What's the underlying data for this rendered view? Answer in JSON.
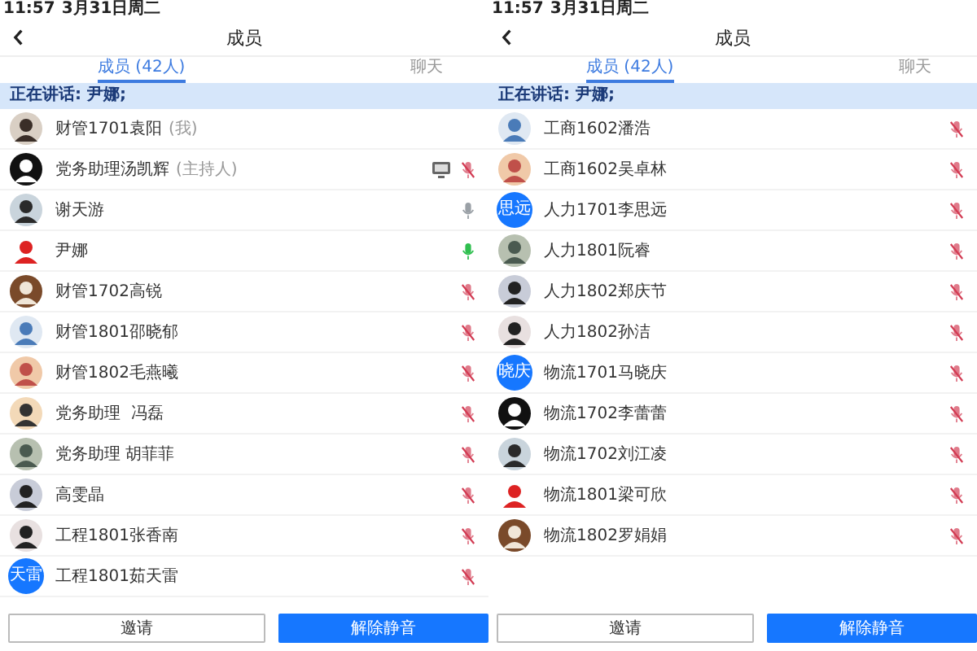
{
  "panels": [
    {
      "status": {
        "time": "11:57",
        "date": "3月31日周二"
      },
      "title": "成员",
      "tabs": [
        {
          "label": "成员 (42人)",
          "selected": true
        },
        {
          "label": "聊天",
          "selected": false
        }
      ],
      "banner": "正在讲话: 尹娜;",
      "members": [
        {
          "kind": "self",
          "name": "财管1701袁阳",
          "note": "(我)"
        },
        {
          "kind": "member",
          "name": "党务助理汤凯辉",
          "note": "(主持人)",
          "muted": true,
          "speaking": false,
          "screen_share": true
        },
        {
          "kind": "member",
          "name": "谢天游",
          "muted": false,
          "speaking": false
        },
        {
          "kind": "member",
          "name": "尹娜",
          "muted": false,
          "speaking": true
        },
        {
          "kind": "member",
          "name": "财管1702高锐",
          "muted": true,
          "speaking": false
        },
        {
          "kind": "member",
          "name": "财管1801邵晓郁",
          "muted": true,
          "speaking": false
        },
        {
          "kind": "member",
          "name": "财管1802毛燕曦",
          "muted": true,
          "speaking": false
        },
        {
          "kind": "member",
          "name": "党务助理  冯磊",
          "muted": true,
          "speaking": false
        },
        {
          "kind": "member",
          "name": "党务助理 胡菲菲",
          "muted": true,
          "speaking": false
        },
        {
          "kind": "member",
          "name": "高雯晶",
          "muted": true,
          "speaking": false
        },
        {
          "kind": "member",
          "name": "工程1801张香南",
          "muted": true,
          "speaking": false
        },
        {
          "kind": "member",
          "name": "工程1801茹天雷",
          "avatar": {
            "kind": "text",
            "text": "天雷"
          },
          "muted": true,
          "speaking": false
        }
      ],
      "buttons": [
        {
          "label": "邀请",
          "kind": "outline"
        },
        {
          "label": "解除静音",
          "kind": "primary"
        }
      ]
    },
    {
      "status": {
        "time": "11:57",
        "date": "3月31日周二"
      },
      "title": "成员",
      "tabs": [
        {
          "label": "成员 (42人)",
          "selected": true
        },
        {
          "label": "聊天",
          "selected": false
        }
      ],
      "banner": "正在讲话: 尹娜;",
      "members": [
        {
          "kind": "member",
          "name": "工商1602潘浩",
          "muted": true,
          "speaking": false
        },
        {
          "kind": "member",
          "name": "工商1602吴卓林",
          "muted": true,
          "speaking": false
        },
        {
          "kind": "member",
          "name": "人力1701李思远",
          "avatar": {
            "kind": "text",
            "text": "思远"
          },
          "muted": true,
          "speaking": false
        },
        {
          "kind": "member",
          "name": "人力1801阮睿",
          "muted": true,
          "speaking": false
        },
        {
          "kind": "member",
          "name": "人力1802郑庆节",
          "muted": true,
          "speaking": false
        },
        {
          "kind": "member",
          "name": "人力1802孙洁",
          "muted": true,
          "speaking": false
        },
        {
          "kind": "member",
          "name": "物流1701马晓庆",
          "avatar": {
            "kind": "text",
            "text": "晓庆"
          },
          "muted": true,
          "speaking": false
        },
        {
          "kind": "member",
          "name": "物流1702李蕾蕾",
          "muted": true,
          "speaking": false
        },
        {
          "kind": "member",
          "name": "物流1702刘江凌",
          "muted": true,
          "speaking": false
        },
        {
          "kind": "member",
          "name": "物流1801梁可欣",
          "muted": true,
          "speaking": false
        },
        {
          "kind": "member",
          "name": "物流1802罗娟娟",
          "muted": true,
          "speaking": false
        }
      ],
      "buttons": [
        {
          "label": "邀请",
          "kind": "outline"
        },
        {
          "label": "解除静音",
          "kind": "primary"
        }
      ]
    }
  ]
}
